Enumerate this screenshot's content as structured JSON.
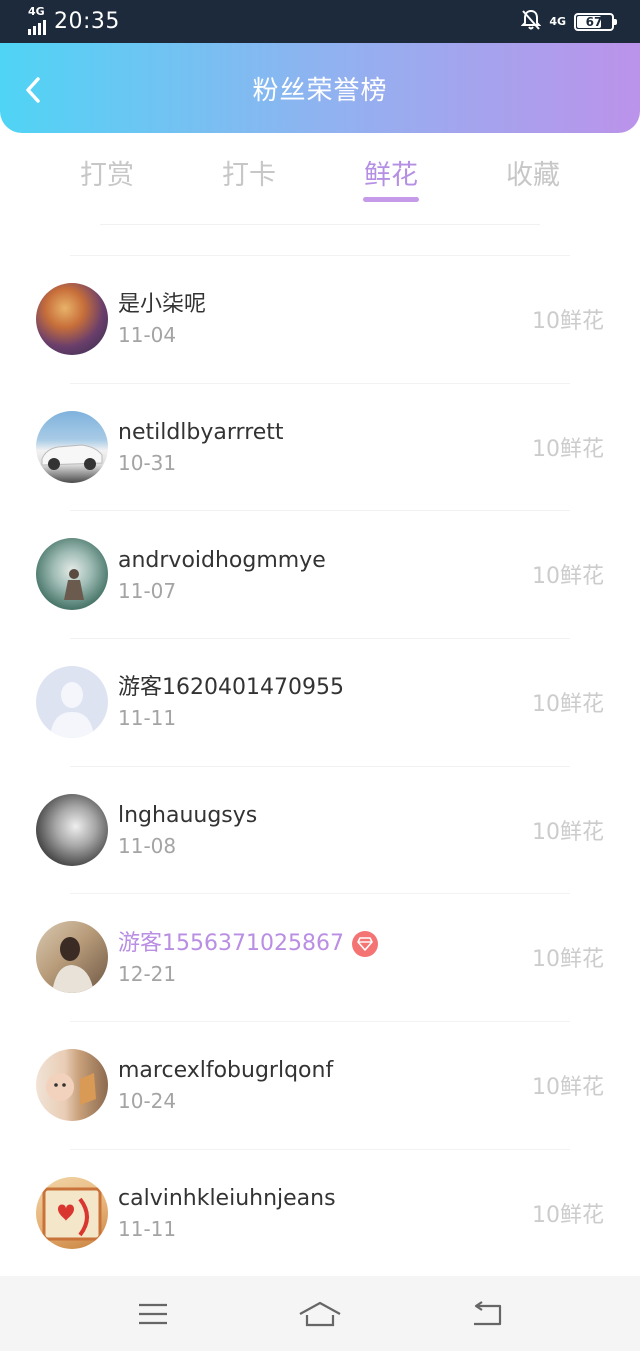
{
  "status_bar": {
    "network_left": "4G",
    "time": "20:35",
    "network_right": "4G",
    "battery": "67"
  },
  "header": {
    "title": "粉丝荣誉榜"
  },
  "tabs": [
    {
      "label": "打赏",
      "active": false
    },
    {
      "label": "打卡",
      "active": false
    },
    {
      "label": "鲜花",
      "active": true
    },
    {
      "label": "收藏",
      "active": false
    }
  ],
  "fans": [
    {
      "name": "是小柒呢",
      "date": "11-04",
      "amount": "10鲜花",
      "vip": false
    },
    {
      "name": "netildlbyarrrett",
      "date": "10-31",
      "amount": "10鲜花",
      "vip": false
    },
    {
      "name": "andrvoidhogmmye",
      "date": "11-07",
      "amount": "10鲜花",
      "vip": false
    },
    {
      "name": "游客1620401470955",
      "date": "11-11",
      "amount": "10鲜花",
      "vip": false
    },
    {
      "name": "lnghauugsys",
      "date": "11-08",
      "amount": "10鲜花",
      "vip": false
    },
    {
      "name": "游客1556371025867",
      "date": "12-21",
      "amount": "10鲜花",
      "vip": true
    },
    {
      "name": "marcexlfobugrlqonf",
      "date": "10-24",
      "amount": "10鲜花",
      "vip": false
    },
    {
      "name": "calvinhkleiuhnjeans",
      "date": "11-11",
      "amount": "10鲜花",
      "vip": false
    }
  ],
  "colors": {
    "header_gradient_start": "#4fd4f5",
    "header_gradient_end": "#bb93ea",
    "active_tab": "#b58fe3",
    "vip_name": "#b98ee3",
    "vip_badge": "#f47474"
  },
  "icons": {
    "back": "chevron-left-icon",
    "vip": "diamond-icon",
    "nav_menu": "menu-icon",
    "nav_home": "home-icon",
    "nav_back": "back-icon"
  }
}
